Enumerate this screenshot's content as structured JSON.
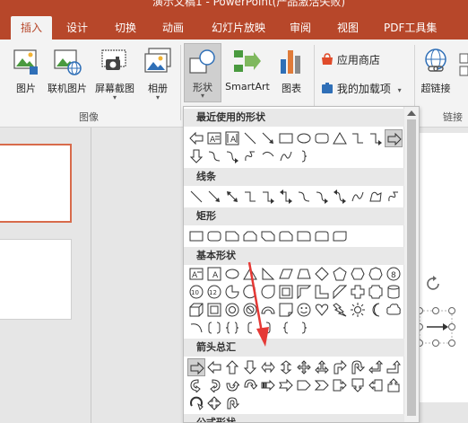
{
  "window": {
    "title": "演示文稿1 - PowerPoint(产品激活失败)"
  },
  "tabs": [
    "插入",
    "设计",
    "切换",
    "动画",
    "幻灯片放映",
    "审阅",
    "视图",
    "PDF工具集"
  ],
  "ribbon": {
    "images_group": {
      "label": "图像",
      "buttons": [
        "图片",
        "联机图片",
        "屏幕截图",
        "相册"
      ]
    },
    "illustrations": {
      "shapes_label": "形状",
      "smartart_label": "SmartArt",
      "chart_label": "图表"
    },
    "addins": {
      "store_label": "应用商店",
      "my_addins_label": "我的加载项"
    },
    "links": {
      "hyperlink_label": "超链接",
      "group_label": "链接"
    }
  },
  "shapes_menu": {
    "sections": [
      "最近使用的形状",
      "线条",
      "矩形",
      "基本形状",
      "箭头总汇",
      "公式形状"
    ]
  },
  "colors": {
    "accent": "#b7472a",
    "annotation_arrow": "#e53935"
  },
  "icons": [
    "picture-icon",
    "online-picture-icon",
    "screenshot-icon",
    "album-icon",
    "shapes-icon",
    "smartart-icon",
    "chart-icon",
    "store-icon",
    "addins-icon",
    "hyperlink-icon"
  ]
}
